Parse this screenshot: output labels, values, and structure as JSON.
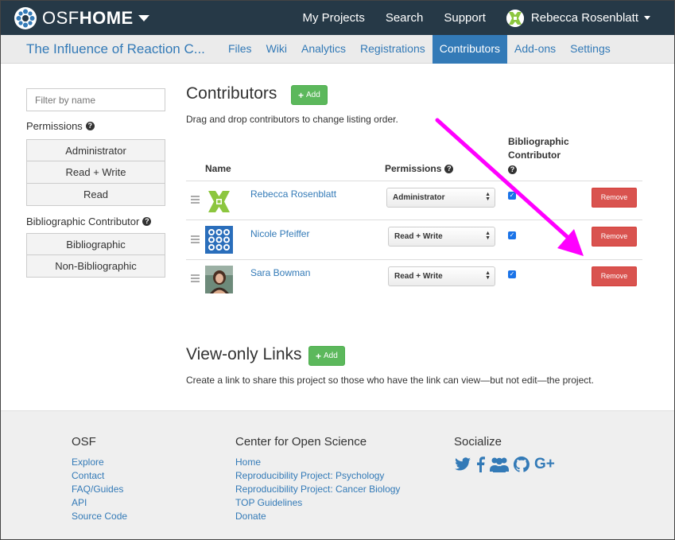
{
  "topnav": {
    "brand_osf": "OSF",
    "brand_home": "HOME",
    "links": [
      "My Projects",
      "Search",
      "Support"
    ],
    "user_name": "Rebecca Rosenblatt"
  },
  "project": {
    "title": "The Influence of Reaction C...",
    "tabs": [
      "Files",
      "Wiki",
      "Analytics",
      "Registrations",
      "Contributors",
      "Add-ons",
      "Settings"
    ],
    "active_tab": "Contributors"
  },
  "filters": {
    "placeholder": "Filter by name",
    "permissions_label": "Permissions",
    "permissions_options": [
      "Administrator",
      "Read + Write",
      "Read"
    ],
    "bibliographic_label": "Bibliographic Contributor",
    "bibliographic_options": [
      "Bibliographic",
      "Non-Bibliographic"
    ]
  },
  "contributors": {
    "heading": "Contributors",
    "add_label": "Add",
    "instructions": "Drag and drop contributors to change listing order.",
    "col_name": "Name",
    "col_permissions": "Permissions",
    "col_bib_line1": "Bibliographic",
    "col_bib_line2": "Contributor",
    "remove_label": "Remove",
    "rows": [
      {
        "name": "Rebecca Rosenblatt",
        "permission": "Administrator",
        "bibliographic": true
      },
      {
        "name": "Nicole Pfeiffer",
        "permission": "Read + Write",
        "bibliographic": true
      },
      {
        "name": "Sara Bowman",
        "permission": "Read + Write",
        "bibliographic": true
      }
    ]
  },
  "viewonly": {
    "heading": "View-only Links",
    "add_label": "Add",
    "description": "Create a link to share this project so those who have the link can view—but not edit—the project."
  },
  "footer": {
    "osf_heading": "OSF",
    "osf_links": [
      "Explore",
      "Contact",
      "FAQ/Guides",
      "API",
      "Source Code"
    ],
    "cos_heading": "Center for Open Science",
    "cos_links": [
      "Home",
      "Reproducibility Project: Psychology",
      "Reproducibility Project: Cancer Biology",
      "TOP Guidelines",
      "Donate"
    ],
    "social_heading": "Socialize",
    "social_icons": [
      "twitter-icon",
      "facebook-icon",
      "group-icon",
      "github-icon",
      "google-plus-icon"
    ],
    "google_plus_text": "G+"
  },
  "colors": {
    "navbar": "#263947",
    "link": "#337ab7",
    "success": "#5cb85c",
    "danger": "#d9534f",
    "annotation_arrow": "#ff00ff"
  }
}
